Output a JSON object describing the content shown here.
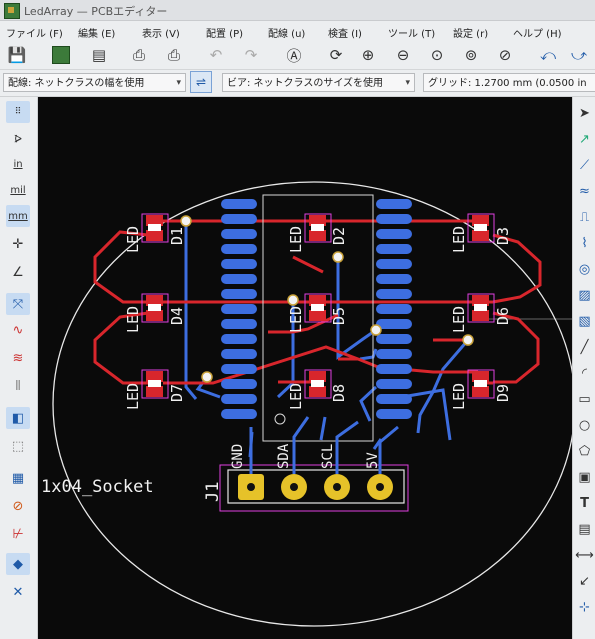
{
  "window": {
    "title": "LedArray — PCBエディター"
  },
  "menu": [
    "ファイル (F)",
    "編集 (E)",
    "表示 (V)",
    "配置 (P)",
    "配線 (u)",
    "検査 (I)",
    "ツール (T)",
    "設定 (r)",
    "ヘルプ (H)"
  ],
  "options": {
    "track_width": "配線: ネットクラスの幅を使用",
    "via_size": "ビア: ネットクラスのサイズを使用",
    "grid": "グリッド: 1.2700 mm (0.0500 in"
  },
  "left_toolbar": {
    "in_label": "in",
    "mil_label": "mil",
    "mm_label": "mm"
  },
  "board": {
    "connector_ref": "J1",
    "connector_value": "1x04_Socket",
    "pin_labels": [
      "GND",
      "SDA",
      "SCL",
      "5V"
    ],
    "led_label": "LED",
    "led_refs": [
      "D1",
      "D2",
      "D3",
      "D4",
      "D5",
      "D6",
      "D7",
      "D8",
      "D9"
    ],
    "colors": {
      "background": "#0a0a0a",
      "front_copper": "#d8262c",
      "back_copper": "#3d6ee0",
      "edge_cuts": "#e8e8e8",
      "pads": "#e6c229",
      "courtyard": "#e040e0"
    }
  }
}
